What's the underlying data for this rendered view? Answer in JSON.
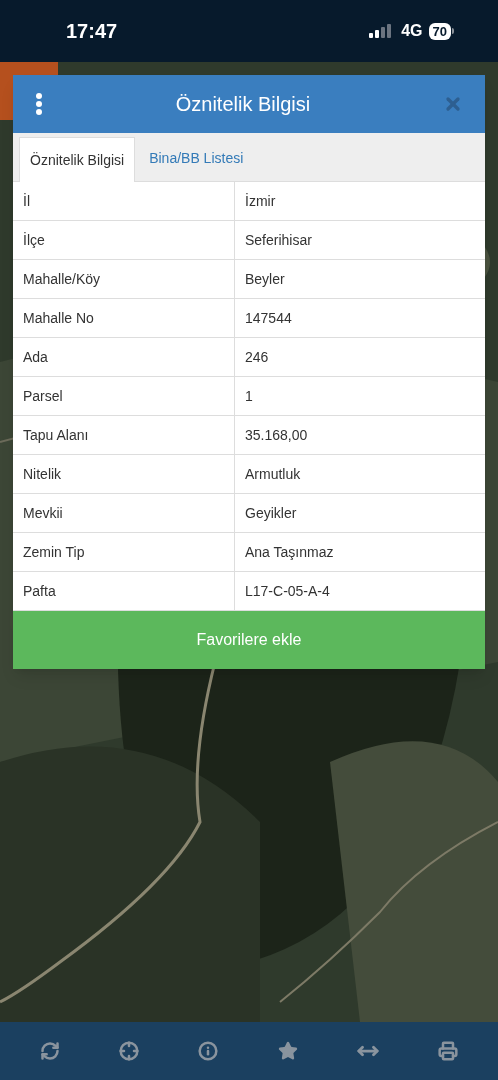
{
  "status_bar": {
    "time": "17:47",
    "network": "4G",
    "battery": "70"
  },
  "dialog": {
    "title": "Öznitelik Bilgisi",
    "tabs": [
      {
        "label": "Öznitelik Bilgisi",
        "selected": true
      },
      {
        "label": "Bina/BB Listesi",
        "selected": false
      }
    ],
    "rows": [
      {
        "label": "İl",
        "value": "İzmir"
      },
      {
        "label": "İlçe",
        "value": "Seferihisar"
      },
      {
        "label": "Mahalle/Köy",
        "value": "Beyler"
      },
      {
        "label": "Mahalle No",
        "value": "147544"
      },
      {
        "label": "Ada",
        "value": "246"
      },
      {
        "label": "Parsel",
        "value": "1"
      },
      {
        "label": "Tapu Alanı",
        "value": "35.168,00"
      },
      {
        "label": "Nitelik",
        "value": "Armutluk"
      },
      {
        "label": "Mevkii",
        "value": "Geyikler"
      },
      {
        "label": "Zemin Tip",
        "value": "Ana Taşınmaz"
      },
      {
        "label": "Pafta",
        "value": "L17-C-05-A-4"
      }
    ],
    "button": "Favorilere ekle"
  }
}
